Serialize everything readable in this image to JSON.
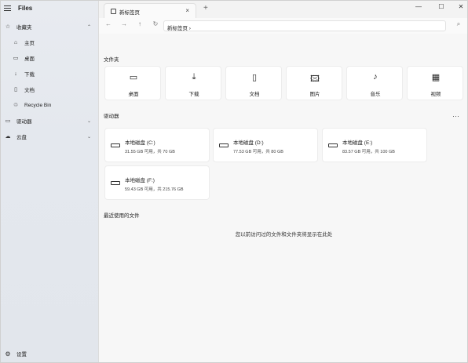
{
  "app": {
    "title": "Files"
  },
  "sidebar": {
    "items": [
      {
        "label": "收藏夹",
        "icon": "star-icon",
        "glyph": "☆",
        "chevron": "⌃"
      },
      {
        "label": "主页",
        "icon": "home-icon",
        "glyph": "⌂"
      },
      {
        "label": "桌面",
        "icon": "desktop-icon",
        "glyph": "▭"
      },
      {
        "label": "下载",
        "icon": "download-icon",
        "glyph": "↓"
      },
      {
        "label": "文档",
        "icon": "document-icon",
        "glyph": "▯"
      },
      {
        "label": "Recycle Bin",
        "icon": "recycle-bin-icon",
        "glyph": "♲"
      },
      {
        "label": "驱动器",
        "icon": "drive-icon",
        "glyph": "▭",
        "chevron": "⌄"
      },
      {
        "label": "云盘",
        "icon": "cloud-icon",
        "glyph": "☁",
        "chevron": "⌄"
      }
    ],
    "settings_label": "设置"
  },
  "tabs": [
    {
      "label": "新标签页"
    }
  ],
  "address_bar": {
    "path": "新标签页 ›"
  },
  "window_buttons": {
    "minimize": "—",
    "maximize": "☐",
    "close": "✕"
  },
  "folders_section": {
    "title": "文件夹",
    "items": [
      {
        "label": "桌面",
        "icon": "desktop-icon",
        "glyph": "▭"
      },
      {
        "label": "下载",
        "icon": "download-icon",
        "glyph": "⤓"
      },
      {
        "label": "文档",
        "icon": "document-icon",
        "glyph": "▯"
      },
      {
        "label": "图片",
        "icon": "pictures-icon",
        "glyph": "🖾"
      },
      {
        "label": "音乐",
        "icon": "music-icon",
        "glyph": "♪"
      },
      {
        "label": "视频",
        "icon": "video-icon",
        "glyph": "▦"
      }
    ]
  },
  "drives_section": {
    "title": "驱动器",
    "items": [
      {
        "name": "本地磁盘 (C:)",
        "space": "31.55 GB 可用，共 70 GB"
      },
      {
        "name": "本地磁盘 (D:)",
        "space": "77.53 GB 可用，共 80 GB"
      },
      {
        "name": "本地磁盘 (E:)",
        "space": "83.57 GB 可用，共 100 GB"
      },
      {
        "name": "本地磁盘 (F:)",
        "space": "59.43 GB 可用，共 215.76 GB"
      }
    ]
  },
  "recent_section": {
    "title": "最近使用的文件",
    "empty_message": "您以前访问过的文件和文件夹将显示在此处"
  }
}
